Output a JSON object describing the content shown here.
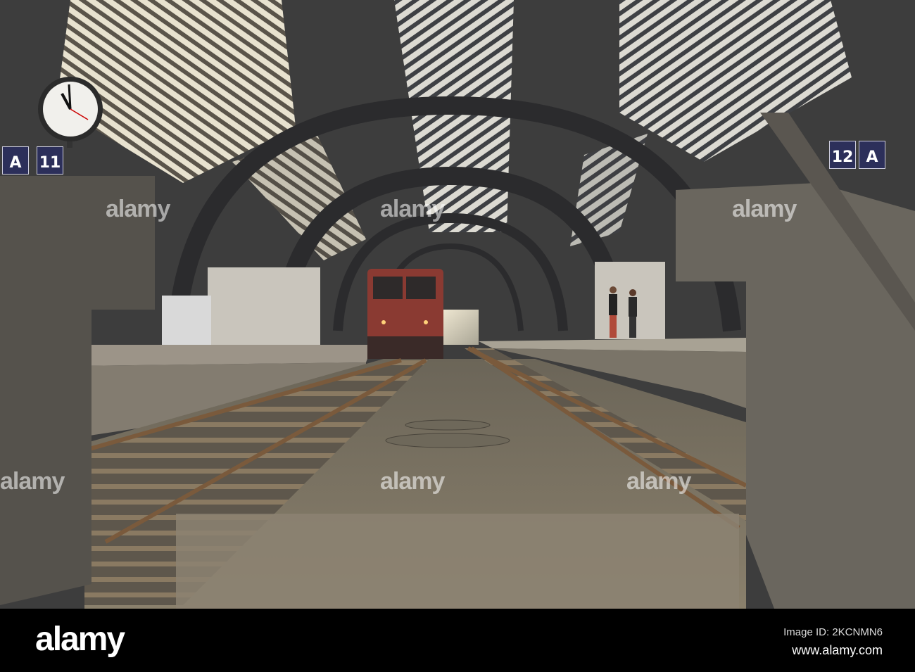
{
  "photo": {
    "subject": "Train station platforms with arched roof",
    "signs": {
      "left_section": "A",
      "left_track": "11",
      "right_track": "12",
      "right_section": "A"
    },
    "watermark": "alamy"
  },
  "banner": {
    "logo": "alamy",
    "image_id": "Image ID: 2KCNMN6",
    "website": "www.alamy.com"
  }
}
